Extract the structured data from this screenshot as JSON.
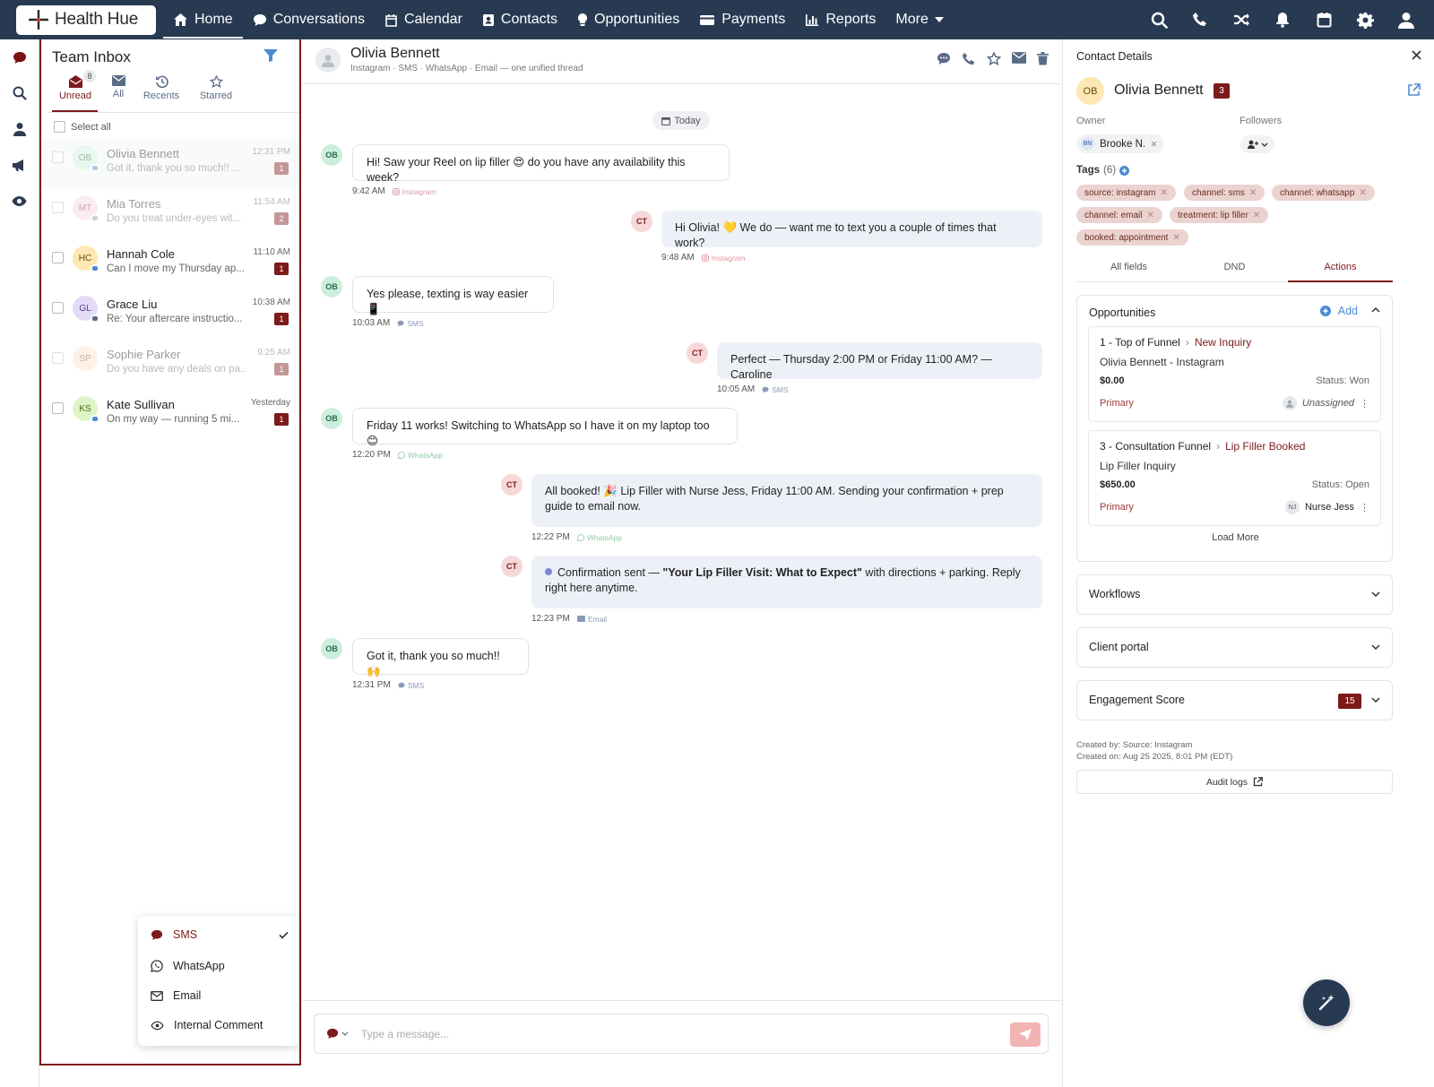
{
  "topnav": {
    "logo": "Health Hue",
    "items": [
      {
        "label": "Home",
        "icon": "home-icon"
      },
      {
        "label": "Conversations",
        "icon": "chat-icon"
      },
      {
        "label": "Calendar",
        "icon": "calendar-icon"
      },
      {
        "label": "Contacts",
        "icon": "contacts-icon"
      },
      {
        "label": "Opportunities",
        "icon": "lightbulb-icon"
      },
      {
        "label": "Payments",
        "icon": "card-icon"
      },
      {
        "label": "Reports",
        "icon": "bar-chart-icon"
      },
      {
        "label": "More",
        "icon": "caret-down-icon"
      }
    ],
    "right_icons": [
      "search-icon",
      "phone-icon",
      "shuffle-icon",
      "bell-icon",
      "calendar-icon",
      "gear-icon",
      "user-icon"
    ]
  },
  "rail": [
    "chat-icon",
    "search-icon",
    "user-icon",
    "megaphone-icon",
    "eye-icon"
  ],
  "inbox": {
    "title": "Team Inbox",
    "tabs": [
      {
        "label": "Unread",
        "icon": "envelope-open-icon",
        "badge": "8"
      },
      {
        "label": "All",
        "icon": "envelope-icon"
      },
      {
        "label": "Recents",
        "icon": "history-icon"
      },
      {
        "label": "Starred",
        "icon": "star-icon"
      }
    ],
    "select_all": "Select all",
    "conversations": [
      {
        "initials": "OB",
        "name": "Olivia Bennett",
        "preview": "Got it, thank you so much!! ...",
        "time": "12:31 PM",
        "count": "1"
      },
      {
        "initials": "MT",
        "name": "Mia Torres",
        "preview": "Do you treat under-eyes wit...",
        "time": "11:54 AM",
        "count": "2"
      },
      {
        "initials": "HC",
        "name": "Hannah Cole",
        "preview": "Can I move my Thursday ap...",
        "time": "11:10 AM",
        "count": "1"
      },
      {
        "initials": "GL",
        "name": "Grace Liu",
        "preview": "Re: Your aftercare instructio...",
        "time": "10:38 AM",
        "count": "1"
      },
      {
        "initials": "SP",
        "name": "Sophie Parker",
        "preview": "Do you have any deals on pa...",
        "time": "9:25 AM",
        "count": "1"
      },
      {
        "initials": "KS",
        "name": "Kate Sullivan",
        "preview": "On my way — running 5 mi...",
        "time": "Yesterday",
        "count": "1"
      }
    ]
  },
  "channel_menu": {
    "items": [
      {
        "label": "SMS",
        "icon": "chat-icon"
      },
      {
        "label": "WhatsApp",
        "icon": "whatsapp-icon"
      },
      {
        "label": "Email",
        "icon": "envelope-icon"
      },
      {
        "label": "Internal Comment",
        "icon": "eye-icon"
      }
    ],
    "selected": "SMS"
  },
  "thread": {
    "name": "Olivia Bennett",
    "subtitle": "Instagram · SMS · WhatsApp · Email — one unified thread",
    "header_icons": [
      "chat-icon",
      "phone-icon",
      "star-icon",
      "envelope-icon",
      "trash-icon"
    ],
    "date_chip": "Today",
    "messages": [
      {
        "from": "OB",
        "dir": "in",
        "text": "Hi! Saw your Reel on lip filler 😍 do you have any availability this week?",
        "time": "9:42 AM",
        "channel": "Instagram"
      },
      {
        "from": "CT",
        "dir": "out",
        "text": "Hi Olivia! 💛 We do — want me to text you a couple of times that work?",
        "time": "9:48 AM",
        "channel": "Instagram"
      },
      {
        "from": "OB",
        "dir": "in",
        "text": "Yes please, texting is way easier 📱",
        "time": "10:03 AM",
        "channel": "SMS"
      },
      {
        "from": "CT",
        "dir": "out",
        "text": "Perfect — Thursday 2:00 PM or Friday 11:00 AM? — Caroline",
        "time": "10:05 AM",
        "channel": "SMS"
      },
      {
        "from": "OB",
        "dir": "in",
        "text": "Friday 11 works! Switching to WhatsApp so I have it on my laptop too 😊",
        "time": "12:20 PM",
        "channel": "WhatsApp"
      },
      {
        "from": "CT",
        "dir": "out",
        "text": "All booked! 🎉 Lip Filler with Nurse Jess, Friday 11:00 AM. Sending your confirmation + prep guide to email now.",
        "time": "12:22 PM",
        "channel": "WhatsApp"
      },
      {
        "from": "CT",
        "dir": "out",
        "text_pre": "Confirmation sent — ",
        "text_bold": "\"Your Lip Filler Visit: What to Expect\"",
        "text_post": " with directions + parking. Reply right here anytime.",
        "time": "12:23 PM",
        "channel": "Email"
      },
      {
        "from": "OB",
        "dir": "in",
        "text": "Got it, thank you so much!! 🙌",
        "time": "12:31 PM",
        "channel": "SMS"
      }
    ],
    "composer_placeholder": "Type a message..."
  },
  "contact": {
    "title": "Contact Details",
    "initials": "OB",
    "name": "Olivia Bennett",
    "badge": "3",
    "owner_label": "Owner",
    "owner_initials": "BN",
    "owner_name": "Brooke N.",
    "followers_label": "Followers",
    "tags_label": "Tags",
    "tags_count": "(6)",
    "tags": [
      "source: instagram",
      "channel: sms",
      "channel: whatsapp",
      "channel: email",
      "treatment: lip filler",
      "booked: appointment"
    ],
    "tabs": [
      "All fields",
      "DND",
      "Actions"
    ],
    "opportunities": {
      "title": "Opportunities",
      "add": "Add",
      "items": [
        {
          "pipeline": "1 - Top of Funnel",
          "stage": "New Inquiry",
          "name": "Olivia Bennett - Instagram",
          "value": "$0.00",
          "status": "Status: Won",
          "primary": "Primary",
          "assignee_initials": "",
          "assignee": "Unassigned"
        },
        {
          "pipeline": "3 - Consultation Funnel",
          "stage": "Lip Filler Booked",
          "name": "Lip Filler Inquiry",
          "value": "$650.00",
          "status": "Status: Open",
          "primary": "Primary",
          "assignee_initials": "NJ",
          "assignee": "Nurse Jess"
        }
      ],
      "load_more": "Load More"
    },
    "sections": [
      {
        "title": "Workflows"
      },
      {
        "title": "Client portal"
      },
      {
        "title": "Engagement Score",
        "badge": "15"
      }
    ],
    "created_by": "Created by: Source: Instagram",
    "created_on": "Created on: Aug 25 2025, 8:01 PM (EDT)",
    "audit": "Audit logs"
  },
  "colors": {
    "nav": "#283a52",
    "accent": "#7d1a1a",
    "tag": "#ebd3d0"
  }
}
